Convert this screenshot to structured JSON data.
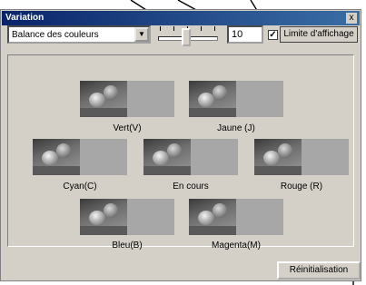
{
  "window": {
    "title": "Variation",
    "close_symbol": "x"
  },
  "controls": {
    "mode_select": {
      "value": "Balance des couleurs"
    },
    "step_slider": {
      "level_fraction": 0.45
    },
    "step_value": "10",
    "display_limit": {
      "checked": true,
      "label": "Limite d'affichage"
    }
  },
  "variations": [
    {
      "label": "Vert(V)"
    },
    {
      "label": "Jaune (J)"
    },
    {
      "label": "Cyan(C)"
    },
    {
      "label": "En cours"
    },
    {
      "label": "Rouge (R)"
    },
    {
      "label": "Bleu(B)"
    },
    {
      "label": "Magenta(M)"
    }
  ],
  "footer": {
    "reset_label": "Réinitialisation"
  },
  "colors": {
    "title_bar": "#0a246a",
    "dialog_bg": "#d4d0c8",
    "swatch": "#a7a7a7"
  }
}
